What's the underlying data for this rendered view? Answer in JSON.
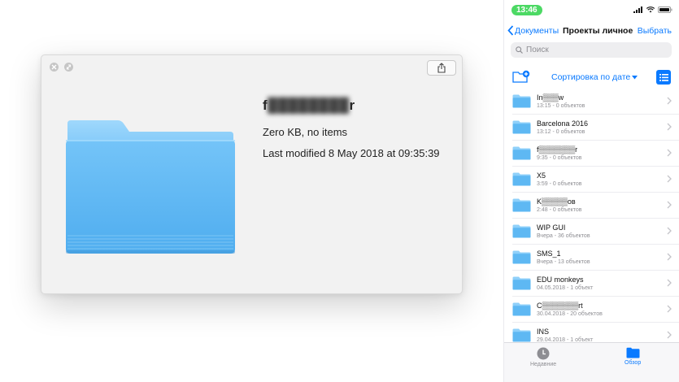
{
  "quicklook": {
    "name_visible_start": "f",
    "name_hidden": "████████",
    "name_visible_end": "r",
    "size": "Zero KB, no items",
    "modified": "Last modified 8 May 2018 at 09:35:39"
  },
  "ios": {
    "status": {
      "time": "13:46"
    },
    "nav": {
      "back_label": "Документы",
      "title": "Проекты личное",
      "select_label": "Выбрать"
    },
    "search": {
      "placeholder": "Поиск"
    },
    "sort_label": "Сортировка по дате",
    "items": [
      {
        "name": "In▒▒▒w",
        "meta": "13:15 - 0 объектов"
      },
      {
        "name": "Barcelona 2016",
        "meta": "13:12 - 0 объектов"
      },
      {
        "name": "f▒▒▒▒▒▒▒r",
        "meta": "9:35 - 0 объектов"
      },
      {
        "name": "X5",
        "meta": "3:59 - 0 объектов"
      },
      {
        "name": "K▒▒▒▒▒ов",
        "meta": "2:48 - 0 объектов"
      },
      {
        "name": "WIP GUI",
        "meta": "Вчера - 36 объектов"
      },
      {
        "name": "SMS_1",
        "meta": "Вчера - 13 объектов"
      },
      {
        "name": "EDU monkeys",
        "meta": "04.05.2018 - 1 объект"
      },
      {
        "name": "C▒▒▒▒▒▒▒rt",
        "meta": "30.04.2018 - 20 объектов"
      },
      {
        "name": "INS",
        "meta": "29.04.2018 - 1 объект"
      }
    ],
    "tabs": {
      "recent": "Недавние",
      "browse": "Обзор"
    }
  },
  "colors": {
    "accent": "#0a7aff",
    "folder_light": "#8fd0fa",
    "folder_main": "#5eb8f3",
    "status_green": "#4cd964"
  }
}
